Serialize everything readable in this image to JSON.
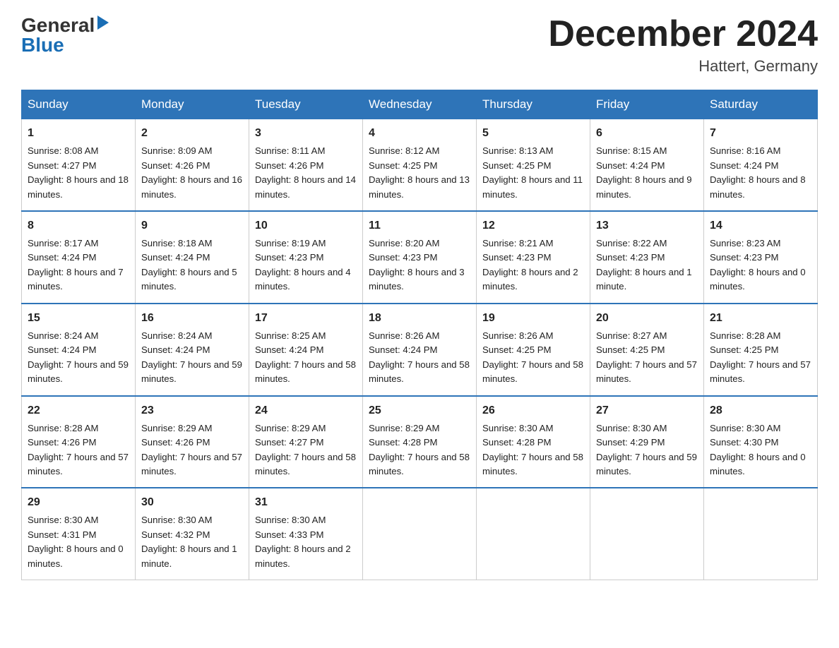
{
  "header": {
    "logo_general": "General",
    "logo_blue": "Blue",
    "month_title": "December 2024",
    "location": "Hattert, Germany"
  },
  "days_of_week": [
    "Sunday",
    "Monday",
    "Tuesday",
    "Wednesday",
    "Thursday",
    "Friday",
    "Saturday"
  ],
  "weeks": [
    [
      {
        "day": "1",
        "sunrise": "8:08 AM",
        "sunset": "4:27 PM",
        "daylight": "8 hours and 18 minutes."
      },
      {
        "day": "2",
        "sunrise": "8:09 AM",
        "sunset": "4:26 PM",
        "daylight": "8 hours and 16 minutes."
      },
      {
        "day": "3",
        "sunrise": "8:11 AM",
        "sunset": "4:26 PM",
        "daylight": "8 hours and 14 minutes."
      },
      {
        "day": "4",
        "sunrise": "8:12 AM",
        "sunset": "4:25 PM",
        "daylight": "8 hours and 13 minutes."
      },
      {
        "day": "5",
        "sunrise": "8:13 AM",
        "sunset": "4:25 PM",
        "daylight": "8 hours and 11 minutes."
      },
      {
        "day": "6",
        "sunrise": "8:15 AM",
        "sunset": "4:24 PM",
        "daylight": "8 hours and 9 minutes."
      },
      {
        "day": "7",
        "sunrise": "8:16 AM",
        "sunset": "4:24 PM",
        "daylight": "8 hours and 8 minutes."
      }
    ],
    [
      {
        "day": "8",
        "sunrise": "8:17 AM",
        "sunset": "4:24 PM",
        "daylight": "8 hours and 7 minutes."
      },
      {
        "day": "9",
        "sunrise": "8:18 AM",
        "sunset": "4:24 PM",
        "daylight": "8 hours and 5 minutes."
      },
      {
        "day": "10",
        "sunrise": "8:19 AM",
        "sunset": "4:23 PM",
        "daylight": "8 hours and 4 minutes."
      },
      {
        "day": "11",
        "sunrise": "8:20 AM",
        "sunset": "4:23 PM",
        "daylight": "8 hours and 3 minutes."
      },
      {
        "day": "12",
        "sunrise": "8:21 AM",
        "sunset": "4:23 PM",
        "daylight": "8 hours and 2 minutes."
      },
      {
        "day": "13",
        "sunrise": "8:22 AM",
        "sunset": "4:23 PM",
        "daylight": "8 hours and 1 minute."
      },
      {
        "day": "14",
        "sunrise": "8:23 AM",
        "sunset": "4:23 PM",
        "daylight": "8 hours and 0 minutes."
      }
    ],
    [
      {
        "day": "15",
        "sunrise": "8:24 AM",
        "sunset": "4:24 PM",
        "daylight": "7 hours and 59 minutes."
      },
      {
        "day": "16",
        "sunrise": "8:24 AM",
        "sunset": "4:24 PM",
        "daylight": "7 hours and 59 minutes."
      },
      {
        "day": "17",
        "sunrise": "8:25 AM",
        "sunset": "4:24 PM",
        "daylight": "7 hours and 58 minutes."
      },
      {
        "day": "18",
        "sunrise": "8:26 AM",
        "sunset": "4:24 PM",
        "daylight": "7 hours and 58 minutes."
      },
      {
        "day": "19",
        "sunrise": "8:26 AM",
        "sunset": "4:25 PM",
        "daylight": "7 hours and 58 minutes."
      },
      {
        "day": "20",
        "sunrise": "8:27 AM",
        "sunset": "4:25 PM",
        "daylight": "7 hours and 57 minutes."
      },
      {
        "day": "21",
        "sunrise": "8:28 AM",
        "sunset": "4:25 PM",
        "daylight": "7 hours and 57 minutes."
      }
    ],
    [
      {
        "day": "22",
        "sunrise": "8:28 AM",
        "sunset": "4:26 PM",
        "daylight": "7 hours and 57 minutes."
      },
      {
        "day": "23",
        "sunrise": "8:29 AM",
        "sunset": "4:26 PM",
        "daylight": "7 hours and 57 minutes."
      },
      {
        "day": "24",
        "sunrise": "8:29 AM",
        "sunset": "4:27 PM",
        "daylight": "7 hours and 58 minutes."
      },
      {
        "day": "25",
        "sunrise": "8:29 AM",
        "sunset": "4:28 PM",
        "daylight": "7 hours and 58 minutes."
      },
      {
        "day": "26",
        "sunrise": "8:30 AM",
        "sunset": "4:28 PM",
        "daylight": "7 hours and 58 minutes."
      },
      {
        "day": "27",
        "sunrise": "8:30 AM",
        "sunset": "4:29 PM",
        "daylight": "7 hours and 59 minutes."
      },
      {
        "day": "28",
        "sunrise": "8:30 AM",
        "sunset": "4:30 PM",
        "daylight": "8 hours and 0 minutes."
      }
    ],
    [
      {
        "day": "29",
        "sunrise": "8:30 AM",
        "sunset": "4:31 PM",
        "daylight": "8 hours and 0 minutes."
      },
      {
        "day": "30",
        "sunrise": "8:30 AM",
        "sunset": "4:32 PM",
        "daylight": "8 hours and 1 minute."
      },
      {
        "day": "31",
        "sunrise": "8:30 AM",
        "sunset": "4:33 PM",
        "daylight": "8 hours and 2 minutes."
      },
      null,
      null,
      null,
      null
    ]
  ]
}
